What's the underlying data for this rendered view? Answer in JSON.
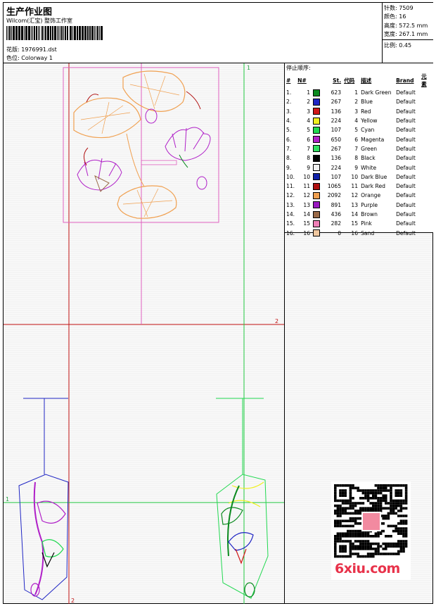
{
  "header": {
    "title": "生产作业图",
    "company": "Wilcom(汇宝) 整饰工作室",
    "design_label": "花版:",
    "design_value": "1976991.dst",
    "colorway_label": "色位:",
    "colorway_value": "Colorway 1"
  },
  "stats": {
    "stitches": "针数: 7509",
    "colors": "颜色: 16",
    "height": "高度: 572.5 mm",
    "width": "宽度: 267.1 mm",
    "scale": "比例: 0.45"
  },
  "stop_sequence": {
    "title": "停止顺序:",
    "headers": [
      "#",
      "N#",
      "",
      "St.",
      "代码",
      "描述",
      "Brand",
      "元素"
    ],
    "rows": [
      {
        "idx": "1.",
        "n": "1",
        "color": "#0b8a1f",
        "st": "623",
        "code": "1",
        "desc": "Dark Green",
        "brand": "Default"
      },
      {
        "idx": "2.",
        "n": "2",
        "color": "#1f25c4",
        "st": "267",
        "code": "2",
        "desc": "Blue",
        "brand": "Default"
      },
      {
        "idx": "3.",
        "n": "3",
        "color": "#d01818",
        "st": "136",
        "code": "3",
        "desc": "Red",
        "brand": "Default"
      },
      {
        "idx": "4.",
        "n": "4",
        "color": "#f0f020",
        "st": "224",
        "code": "4",
        "desc": "Yellow",
        "brand": "Default"
      },
      {
        "idx": "5.",
        "n": "5",
        "color": "#20d850",
        "st": "107",
        "code": "5",
        "desc": "Cyan",
        "brand": "Default"
      },
      {
        "idx": "6.",
        "n": "6",
        "color": "#b020c8",
        "st": "650",
        "code": "6",
        "desc": "Magenta",
        "brand": "Default"
      },
      {
        "idx": "7.",
        "n": "7",
        "color": "#30e060",
        "st": "267",
        "code": "7",
        "desc": "Green",
        "brand": "Default"
      },
      {
        "idx": "8.",
        "n": "8",
        "color": "#000000",
        "st": "136",
        "code": "8",
        "desc": "Black",
        "brand": "Default"
      },
      {
        "idx": "9.",
        "n": "9",
        "color": "#f0f0f0",
        "st": "224",
        "code": "9",
        "desc": "White",
        "brand": "Default"
      },
      {
        "idx": "10.",
        "n": "10",
        "color": "#1020a8",
        "st": "107",
        "code": "10",
        "desc": "Dark Blue",
        "brand": "Default"
      },
      {
        "idx": "11.",
        "n": "11",
        "color": "#b01010",
        "st": "1065",
        "code": "11",
        "desc": "Dark Red",
        "brand": "Default"
      },
      {
        "idx": "12.",
        "n": "12",
        "color": "#f0a050",
        "st": "2092",
        "code": "12",
        "desc": "Orange",
        "brand": "Default"
      },
      {
        "idx": "13.",
        "n": "13",
        "color": "#9a18c0",
        "st": "891",
        "code": "13",
        "desc": "Purple",
        "brand": "Default"
      },
      {
        "idx": "14.",
        "n": "14",
        "color": "#9a6a48",
        "st": "436",
        "code": "14",
        "desc": "Brown",
        "brand": "Default"
      },
      {
        "idx": "15.",
        "n": "15",
        "color": "#f080b8",
        "st": "282",
        "code": "15",
        "desc": "Pink",
        "brand": "Default"
      },
      {
        "idx": "16.",
        "n": "16",
        "color": "#f0c8a0",
        "st": "0",
        "code": "16",
        "desc": "Sand",
        "brand": "Default"
      }
    ]
  },
  "guides": {
    "label_1": "1",
    "label_2": "2"
  },
  "watermark": {
    "site": "6xiu.com"
  }
}
